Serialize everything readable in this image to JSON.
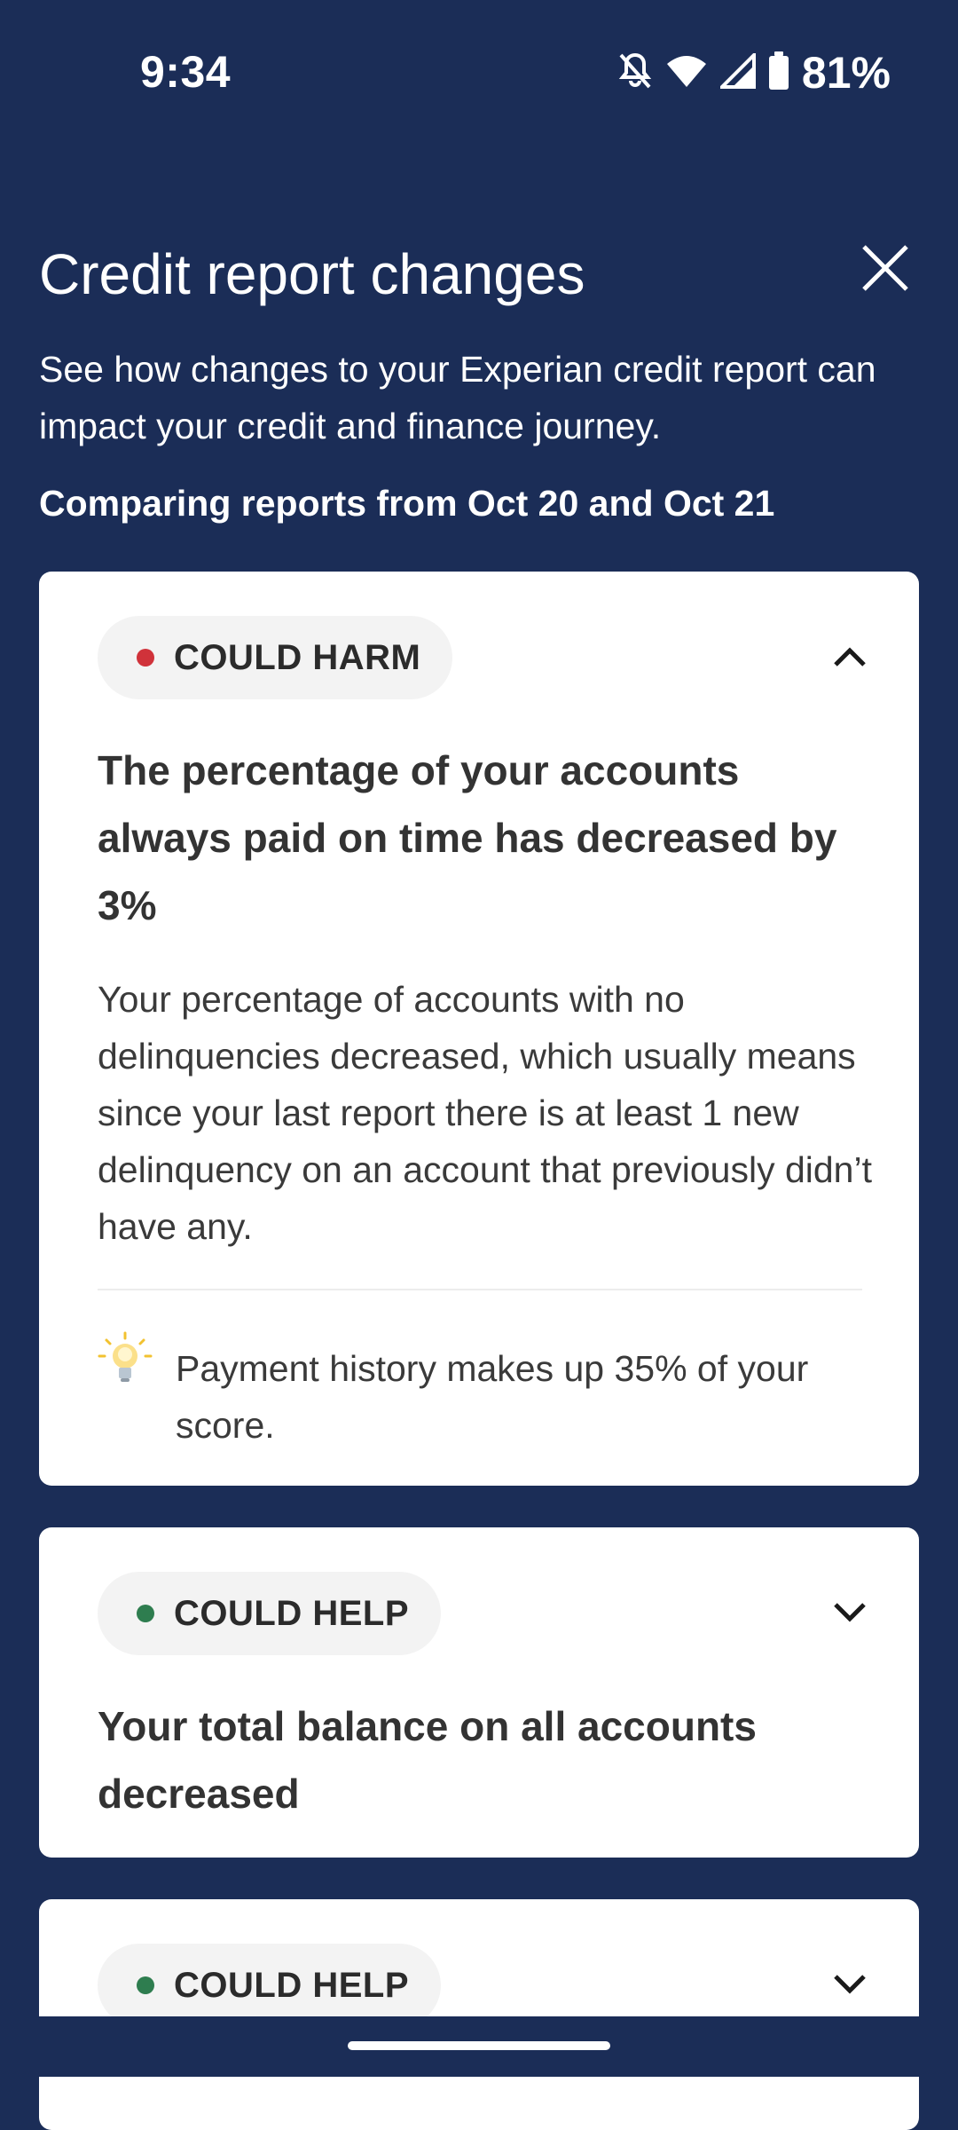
{
  "status_bar": {
    "time": "9:34",
    "battery_percent": "81%",
    "icons": [
      "notifications-off-icon",
      "wifi-icon",
      "cell-signal-icon",
      "battery-icon"
    ]
  },
  "header": {
    "title": "Credit report changes",
    "description": "See how changes to your Experian credit report can impact your credit and finance journey.",
    "comparing": "Comparing reports from Oct 20 and Oct 21",
    "close_icon": "close-icon"
  },
  "cards": [
    {
      "badge_label": "COULD HARM",
      "badge_color": "#d0323a",
      "expanded": true,
      "heading": "The percentage of your accounts always paid on time has decreased by 3%",
      "body": "Your percentage of accounts with no delinquencies decreased, which usually means since your last report there is at least 1 new delinquency on an account that previously didn’t have any.",
      "tip_icon": "lightbulb-icon",
      "tip": "Payment history makes up 35% of your score."
    },
    {
      "badge_label": "COULD HELP",
      "badge_color": "#2e7d4f",
      "expanded": false,
      "heading": "Your total balance on all accounts decreased"
    },
    {
      "badge_label": "COULD HELP",
      "badge_color": "#2e7d4f",
      "expanded": false
    }
  ],
  "colors": {
    "background": "#1b2d57",
    "card": "#ffffff",
    "harm": "#d0323a",
    "help": "#2e7d4f"
  }
}
